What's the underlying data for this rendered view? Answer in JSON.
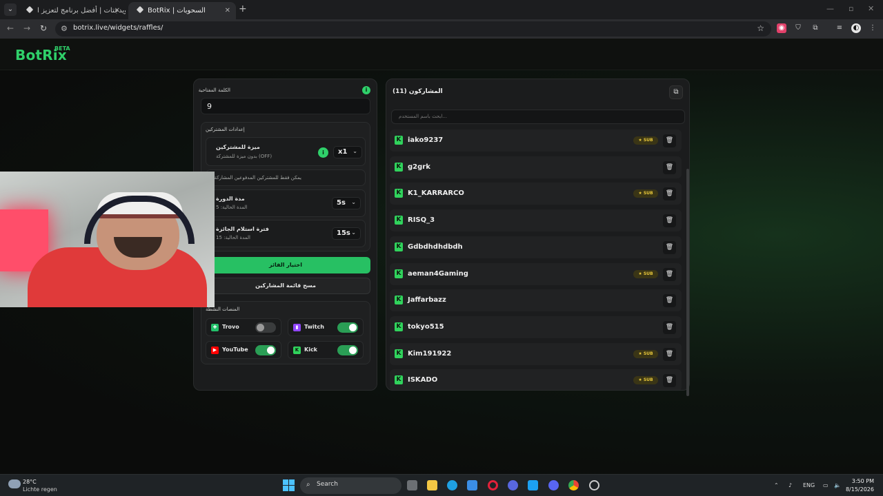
{
  "browser": {
    "tabs": [
      {
        "title": "الويدجتات | أفضل برنامج لتعزيز ا..."
      },
      {
        "title": "BotRix | السحوبات"
      }
    ],
    "url": "botrix.live/widgets/raffles/"
  },
  "site": {
    "logo": "BotRix",
    "logo_badge": "BETA"
  },
  "settings": {
    "keyword_label": "الكلمة المفتاحية",
    "keyword_value": "9",
    "participant_settings_title": "إعدادات المشتركين",
    "subscriber_luck_title": "ميزة للمشتركين",
    "subscriber_luck_sub": "بدون ميزة للمشتركة (OFF)",
    "subscriber_luck_value": "x1",
    "subs_only_note": "يمكن فقط للمشتركين المدفوعين المشاركة",
    "round_duration_title": "مدة الدورة",
    "round_duration_sub": "المدة الحالية: 5",
    "round_duration_value": "5s",
    "claim_period_title": "فترة استلام الجائزة",
    "claim_period_sub": "المدة الحالية: 15",
    "claim_period_value": "15s",
    "pick_winner_label": "اختيار الفائز",
    "clear_list_label": "مسح قائمة المشاركين",
    "platforms_title": "المنصات النشطة",
    "platforms": [
      {
        "name": "Trovo",
        "enabled": false,
        "color": "#23c06a"
      },
      {
        "name": "Twitch",
        "enabled": true,
        "color": "#9146ff"
      },
      {
        "name": "YouTube",
        "enabled": true,
        "color": "#ff0000"
      },
      {
        "name": "Kick",
        "enabled": true,
        "color": "#53fc18"
      }
    ]
  },
  "participants": {
    "title": "المشاركون (11)",
    "search_placeholder": "...ابحث باسم المستخدم",
    "sub_badge": "SUB",
    "items": [
      {
        "name": "iako9237",
        "sub": true
      },
      {
        "name": "g2grk",
        "sub": false
      },
      {
        "name": "K1_KARRARCO",
        "sub": true
      },
      {
        "name": "RISQ_3",
        "sub": false
      },
      {
        "name": "Gdbdhdhdbdh",
        "sub": false
      },
      {
        "name": "aeman4Gaming",
        "sub": true
      },
      {
        "name": "Jaffarbazz",
        "sub": false
      },
      {
        "name": "tokyo515",
        "sub": false
      },
      {
        "name": "Kim191922",
        "sub": true
      },
      {
        "name": "ISKADO",
        "sub": true
      }
    ]
  },
  "taskbar": {
    "temperature": "28°C",
    "condition": "Lichte regen",
    "search_label": "Search",
    "language": "ENG",
    "time": "3:50 PM",
    "date": "8/15/2026"
  },
  "colors": {
    "accent": "#2fd06a",
    "kick": "#30d35c",
    "sub_badge": "#e9c83a"
  }
}
